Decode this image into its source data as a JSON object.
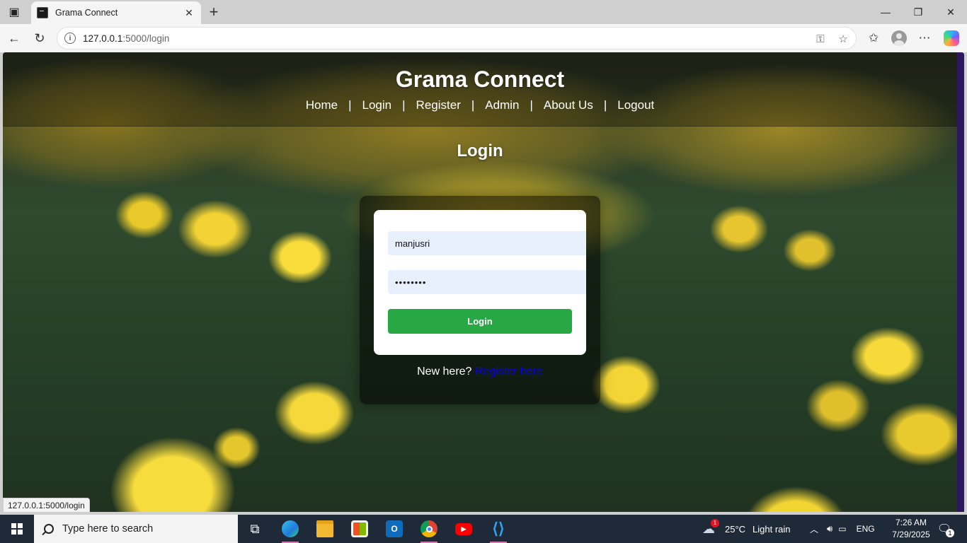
{
  "browser": {
    "tab_title": "Grama Connect",
    "tab_close": "✕",
    "new_tab": "+",
    "url_host": "127.0.0.1",
    "url_path": ":5000/login",
    "status_url": "127.0.0.1:5000/login"
  },
  "site": {
    "title": "Grama Connect",
    "nav": [
      "Home",
      "Login",
      "Register",
      "Admin",
      "About Us",
      "Logout"
    ],
    "separator": "|"
  },
  "login": {
    "heading": "Login",
    "username_value": "manjusri",
    "password_value": "••••••••",
    "button_label": "Login",
    "new_here_text": "New here?",
    "register_link": "Register here"
  },
  "taskbar": {
    "search_placeholder": "Type here to search",
    "weather_temp": "25°C",
    "weather_desc": "Light rain",
    "weather_badge": "1",
    "language": "ENG",
    "time": "7:26 AM",
    "date": "7/29/2025",
    "notification_count": "1"
  },
  "colors": {
    "login_button": "#28a745",
    "register_link": "#0a00ee",
    "taskbar": "#1f2a38"
  }
}
